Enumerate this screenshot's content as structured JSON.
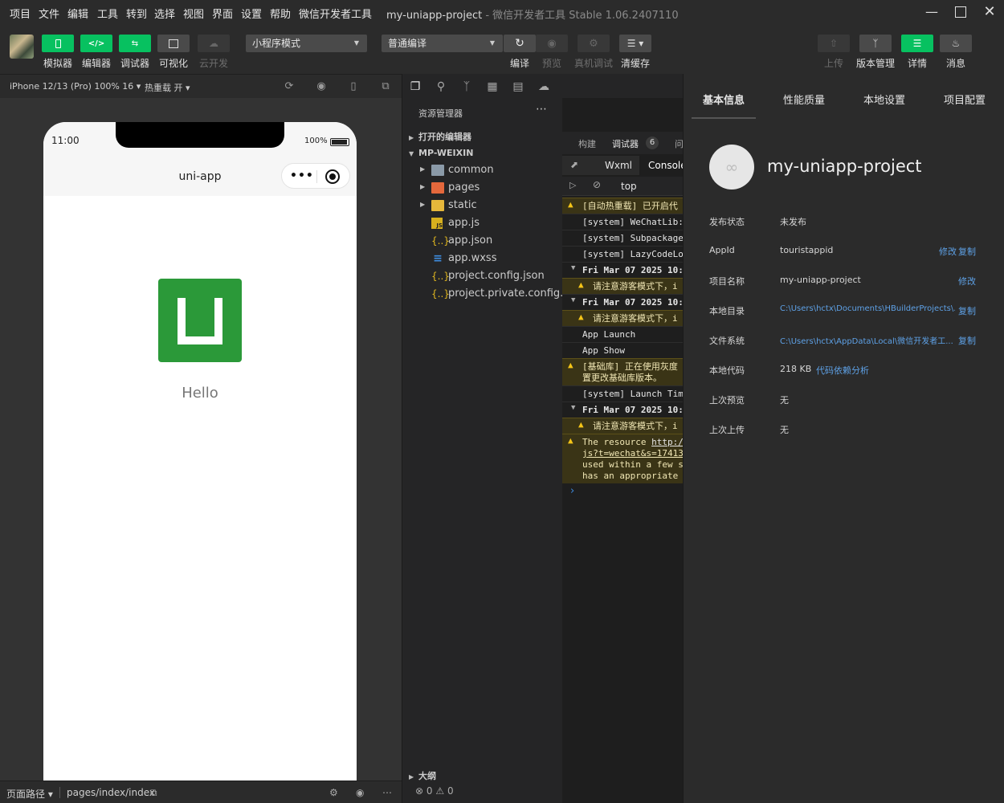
{
  "menu": {
    "items": [
      "项目",
      "文件",
      "编辑",
      "工具",
      "转到",
      "选择",
      "视图",
      "界面",
      "设置",
      "帮助",
      "微信开发者工具"
    ],
    "title": "my-uniapp-project",
    "subtitle": "- 微信开发者工具 Stable 1.06.2407110"
  },
  "toolbar": {
    "simulator": "模拟器",
    "editor": "编辑器",
    "debugger": "调试器",
    "visual": "可视化",
    "cloud": "云开发",
    "mode": "小程序模式",
    "compile_mode": "普通编译",
    "compile": "编译",
    "preview": "预览",
    "device_debug": "真机调试",
    "clear_cache": "清缓存",
    "upload": "上传",
    "version": "版本管理",
    "details": "详情",
    "messages": "消息"
  },
  "simulator": {
    "device": "iPhone 12/13 (Pro) 100% 16 ▾",
    "hot_reload": "热重载 开 ▾",
    "time": "11:00",
    "battery": "100%",
    "nav_title": "uni-app",
    "hello": "Hello",
    "page_path_label": "页面路径 ▾",
    "page_path": "pages/index/index"
  },
  "explorer": {
    "title": "资源管理器",
    "open_editors": "打开的编辑器",
    "project": "MP-WEIXIN",
    "outline": "大纲",
    "files": [
      {
        "name": "common",
        "icon": "folder"
      },
      {
        "name": "pages",
        "icon": "folder-pages"
      },
      {
        "name": "static",
        "icon": "folder-static"
      },
      {
        "name": "app.js",
        "icon": "js"
      },
      {
        "name": "app.json",
        "icon": "json"
      },
      {
        "name": "app.wxss",
        "icon": "css"
      },
      {
        "name": "project.config.json",
        "icon": "json"
      },
      {
        "name": "project.private.config.js...",
        "icon": "json"
      }
    ],
    "problems": "0",
    "warnings": "0"
  },
  "console": {
    "tabs": {
      "build": "构建",
      "debugger": "调试器",
      "count": "6",
      "issues": "问"
    },
    "sub_tabs": {
      "wxml": "Wxml",
      "console": "Console"
    },
    "context": "top",
    "logs": [
      {
        "type": "warn",
        "text": "[自动热重载] 已开启代"
      },
      {
        "type": "plain",
        "text": "[system] WeChatLib:"
      },
      {
        "type": "plain",
        "text": "[system] Subpackage"
      },
      {
        "type": "plain",
        "text": "[system] LazyCodeLo"
      },
      {
        "type": "group",
        "text": "Fri Mar 07 2025 10:"
      },
      {
        "type": "warn-indent",
        "text": "请注意游客模式下，i"
      },
      {
        "type": "group",
        "text": "Fri Mar 07 2025 10:"
      },
      {
        "type": "warn-indent",
        "text": "请注意游客模式下，i"
      },
      {
        "type": "plain",
        "text": "App Launch"
      },
      {
        "type": "plain",
        "text": "App Show"
      },
      {
        "type": "warn2",
        "line1": "[基础库] 正在使用灰度",
        "line2": "置更改基础库版本。"
      },
      {
        "type": "plain",
        "text": "[system] Launch Tim"
      },
      {
        "type": "group",
        "text": "Fri Mar 07 2025 10:"
      },
      {
        "type": "warn-indent",
        "text": "请注意游客模式下，i"
      },
      {
        "type": "warn4",
        "line1a": "The resource ",
        "line1b": "http:/",
        "line2": "js?t=wechat&s=17413",
        "line3": "used within a few s",
        "line4": "has an appropriate"
      }
    ]
  },
  "details": {
    "tabs": [
      "基本信息",
      "性能质量",
      "本地设置",
      "项目配置"
    ],
    "project_name": "my-uniapp-project",
    "rows": {
      "status": {
        "key": "发布状态",
        "value": "未发布"
      },
      "appid": {
        "key": "AppId",
        "value": "touristappid",
        "action1": "修改",
        "action2": "复制"
      },
      "name": {
        "key": "项目名称",
        "value": "my-uniapp-project",
        "action1": "修改"
      },
      "local_dir": {
        "key": "本地目录",
        "value": "C:\\Users\\hctx\\Documents\\HBuilderProjects\\...",
        "action2": "复制"
      },
      "fs": {
        "key": "文件系统",
        "value": "C:\\Users\\hctx\\AppData\\Local\\微信开发者工...",
        "action2": "复制"
      },
      "code": {
        "key": "本地代码",
        "value": "218 KB",
        "action1": "代码依赖分析"
      },
      "last_preview": {
        "key": "上次预览",
        "value": "无"
      },
      "last_upload": {
        "key": "上次上传",
        "value": "无"
      }
    }
  }
}
